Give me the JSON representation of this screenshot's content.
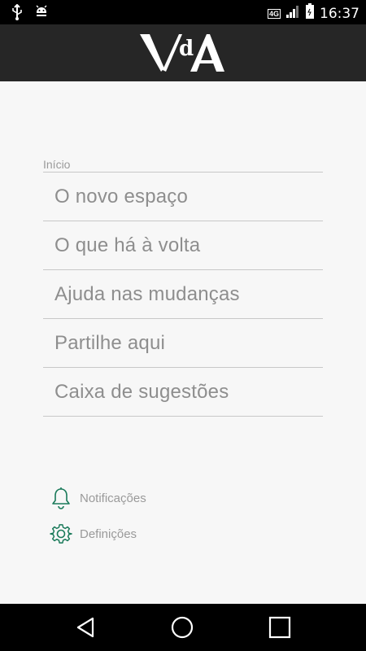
{
  "status_bar": {
    "time": "16:37",
    "network_label": "4G",
    "left_icons": [
      "usb-icon",
      "android-debug-icon"
    ],
    "right_icons": [
      "network-4g-icon",
      "signal-icon",
      "battery-icon"
    ]
  },
  "app_bar": {
    "logo_text": "VdA",
    "logo_icon": "vda-logo"
  },
  "menu": {
    "section_label": "Início",
    "items": [
      {
        "label": "O novo espaço"
      },
      {
        "label": "O que há à volta"
      },
      {
        "label": "Ajuda nas mudanças"
      },
      {
        "label": "Partilhe aqui"
      },
      {
        "label": "Caixa de sugestões"
      }
    ]
  },
  "bottom_links": [
    {
      "label": "Notificações",
      "icon": "bell-icon"
    },
    {
      "label": "Definições",
      "icon": "gear-icon"
    }
  ],
  "nav_bar": {
    "buttons": [
      "back-icon",
      "home-icon",
      "recents-icon"
    ]
  },
  "colors": {
    "accent": "#1a7a5a",
    "app_bar": "#262626",
    "background": "#f7f7f7",
    "menu_text": "#8e8e8e"
  }
}
